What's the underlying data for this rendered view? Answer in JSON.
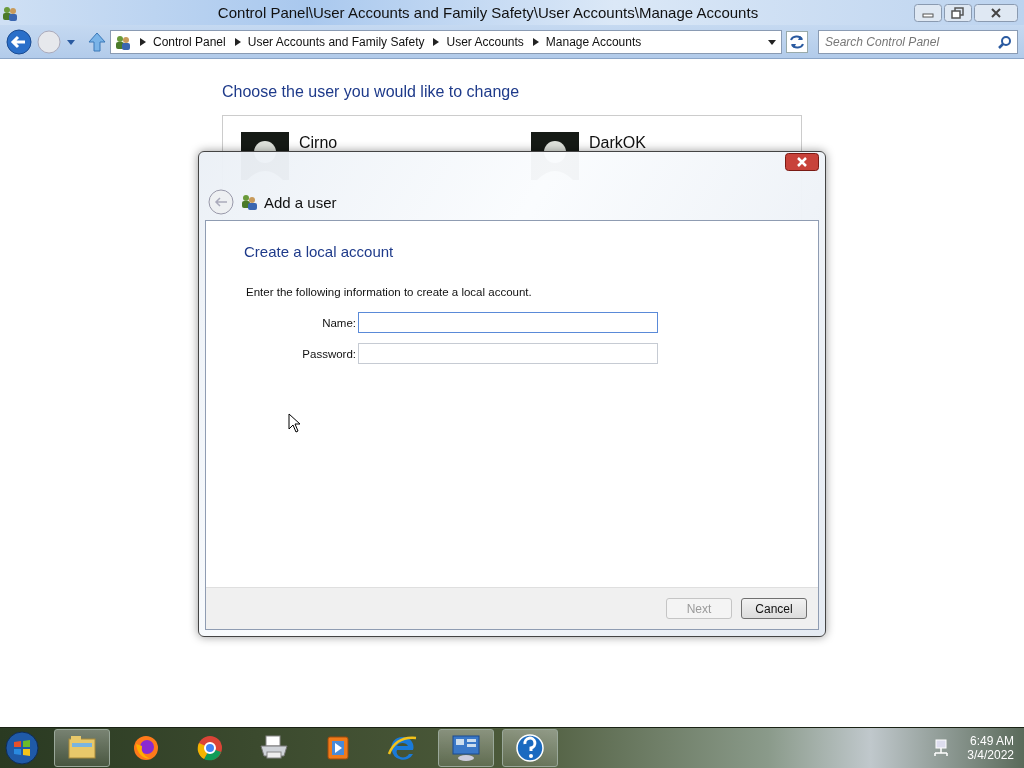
{
  "window": {
    "title": "Control Panel\\User Accounts and Family Safety\\User Accounts\\Manage Accounts"
  },
  "navigation": {
    "breadcrumbs": [
      "Control Panel",
      "User Accounts and Family Safety",
      "User Accounts",
      "Manage Accounts"
    ],
    "search": {
      "placeholder": "Search Control Panel"
    }
  },
  "content": {
    "heading": "Choose the user you would like to change",
    "users": [
      {
        "name": "Cirno"
      },
      {
        "name": "DarkOK"
      }
    ]
  },
  "dialog": {
    "title": "Add a user",
    "heading": "Create a local account",
    "instruction": "Enter the following information to create a local account.",
    "fields": [
      {
        "label": "Name:",
        "focused": true
      },
      {
        "label": "Password:",
        "focused": false
      }
    ],
    "buttons": [
      {
        "label": "Next",
        "disabled": true
      },
      {
        "label": "Cancel",
        "disabled": false
      }
    ]
  },
  "taskbar": {
    "items": [
      {
        "kind": "explorer",
        "active": true
      },
      {
        "kind": "firefox",
        "active": false
      },
      {
        "kind": "chrome",
        "active": false
      },
      {
        "kind": "printer",
        "active": false
      },
      {
        "kind": "media",
        "active": false
      },
      {
        "kind": "ie",
        "active": false
      },
      {
        "kind": "control-panel",
        "active": true
      },
      {
        "kind": "help",
        "active": true
      }
    ],
    "time": "6:49 AM",
    "date": "3/4/2022"
  }
}
